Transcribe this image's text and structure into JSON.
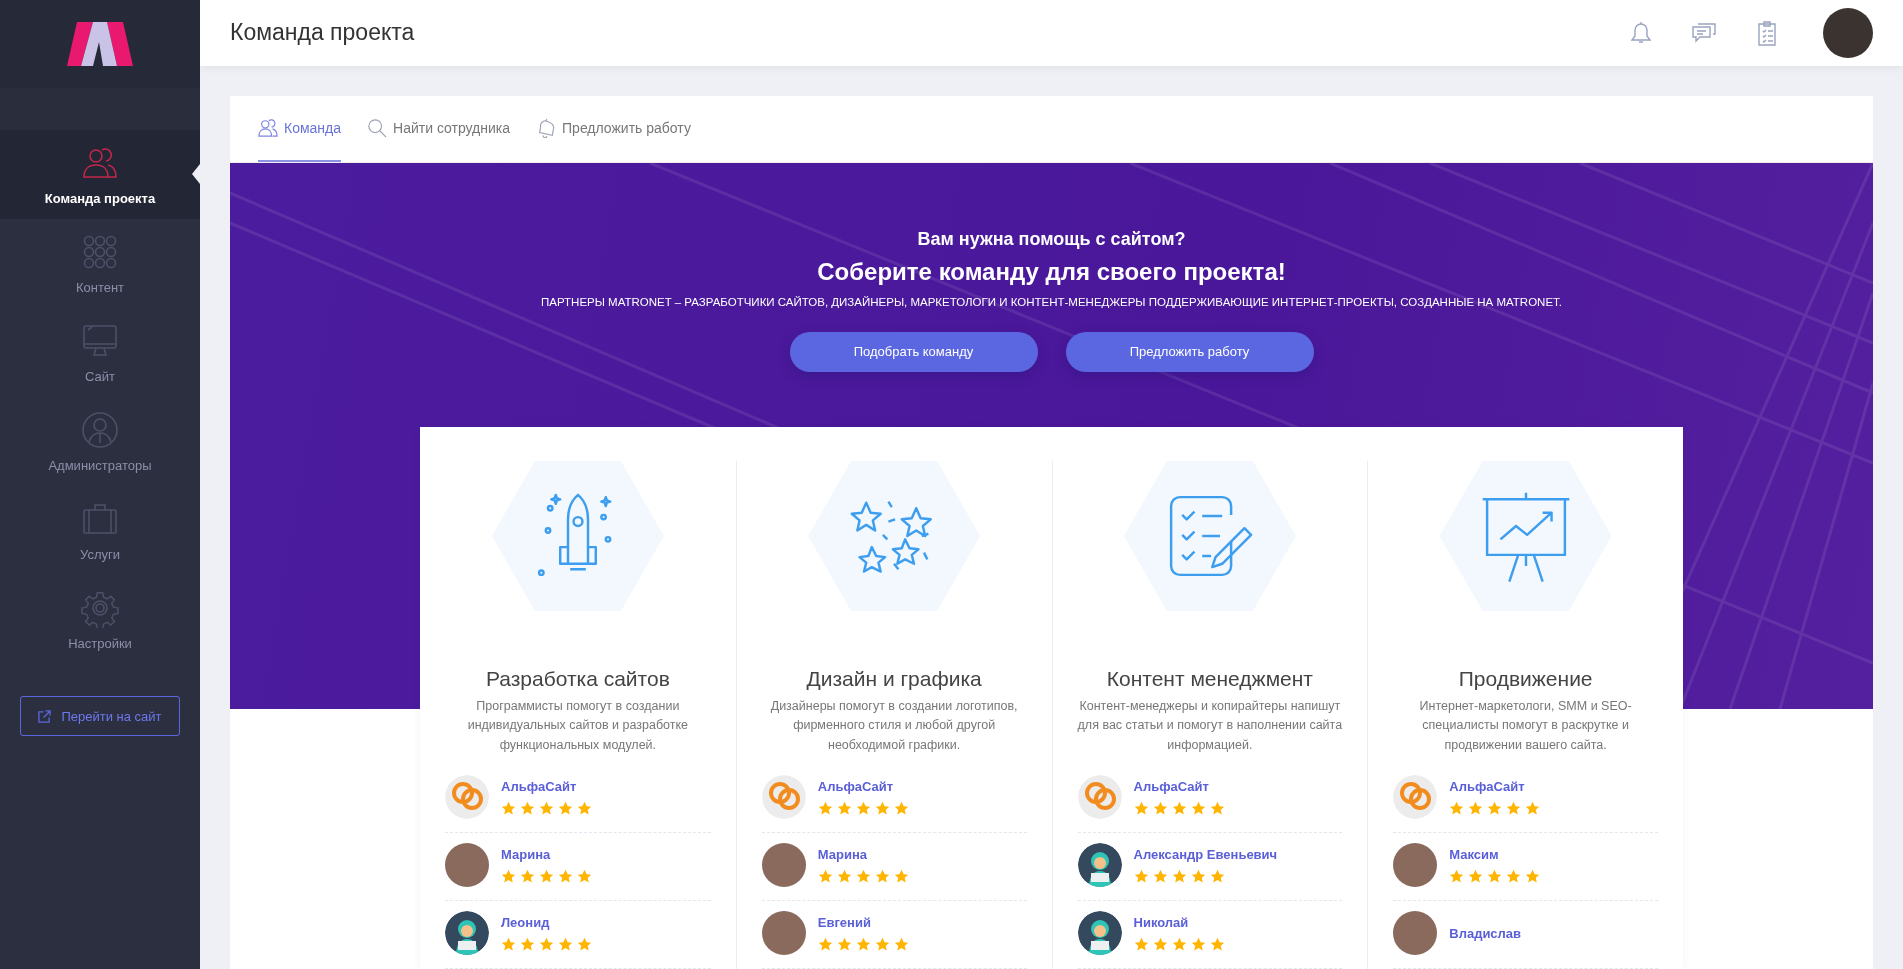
{
  "sidebar": {
    "items": [
      {
        "label": "Команда проекта",
        "kind": "people",
        "selected": true
      },
      {
        "label": "Контент",
        "kind": "grid",
        "selected": false
      },
      {
        "label": "Сайт",
        "kind": "monitor",
        "selected": false
      },
      {
        "label": "Администраторы",
        "kind": "person",
        "selected": false
      },
      {
        "label": "Услуги",
        "kind": "case",
        "selected": false
      },
      {
        "label": "Настройки",
        "kind": "gear",
        "selected": false
      }
    ],
    "site_button": "Перейти на сайт"
  },
  "header": {
    "title": "Команда проекта"
  },
  "tabs": [
    {
      "label": "Команда",
      "kind": "people",
      "selected": true
    },
    {
      "label": "Найти сотрудника",
      "kind": "search",
      "selected": false
    },
    {
      "label": "Предложить работу",
      "kind": "bell",
      "selected": false
    }
  ],
  "banner": {
    "question": "Вам нужна помощь с сайтом?",
    "headline": "Соберите команду для своего проекта!",
    "subtitle": "ПАРТНЕРЫ MATRONET – РАЗРАБОТЧИКИ САЙТОВ, ДИЗАЙНЕРЫ, МАРКЕТОЛОГИ И КОНТЕНТ-МЕНЕДЖЕРЫ ПОДДЕРЖИВАЮЩИЕ ИНТЕРНЕТ-ПРОЕКТЫ, СОЗДАННЫЕ НА MATRONET.",
    "buttons": [
      "Подобрать команду",
      "Предложить работу"
    ]
  },
  "categories": [
    {
      "kind": "rocket",
      "title": "Разработка сайтов",
      "description": "Программисты помогут в создании индивидуальных сайтов и разработке функциональных модулей.",
      "members": [
        {
          "name": "АльфаСайт",
          "kind": "logo",
          "stars": 5
        },
        {
          "name": "Марина",
          "kind": "photo",
          "stars": 5
        },
        {
          "name": "Леонид",
          "kind": "silhouette",
          "stars": 5
        }
      ]
    },
    {
      "kind": "stars",
      "title": "Дизайн и графика",
      "description": "Дизайнеры помогут в создании логотипов, фирменного стиля и любой другой необходимой графики.",
      "members": [
        {
          "name": "АльфаСайт",
          "kind": "logo",
          "stars": 5
        },
        {
          "name": "Марина",
          "kind": "photo",
          "stars": 5
        },
        {
          "name": "Евгений",
          "kind": "photo",
          "stars": 5
        }
      ]
    },
    {
      "kind": "checklist",
      "title": "Контент менеджмент",
      "description": "Контент-менеджеры и копирайтеры напишут для вас статьи и помогут в наполнении сайта информацией.",
      "members": [
        {
          "name": "АльфаСайт",
          "kind": "logo",
          "stars": 5
        },
        {
          "name": "Александр Евеньевич",
          "kind": "silhouette",
          "stars": 5
        },
        {
          "name": "Николай",
          "kind": "silhouette",
          "stars": 5
        }
      ]
    },
    {
      "kind": "chart",
      "title": "Продвижение",
      "description": "Интернет-маркетологи, SMM и SEO-специалисты помогут в раскрутке и продвижении вашего сайта.",
      "members": [
        {
          "name": "АльфаСайт",
          "kind": "logo",
          "stars": 5
        },
        {
          "name": "Максим",
          "kind": "photo",
          "stars": 5
        },
        {
          "name": "Владислав",
          "kind": "photo"
        }
      ]
    }
  ]
}
